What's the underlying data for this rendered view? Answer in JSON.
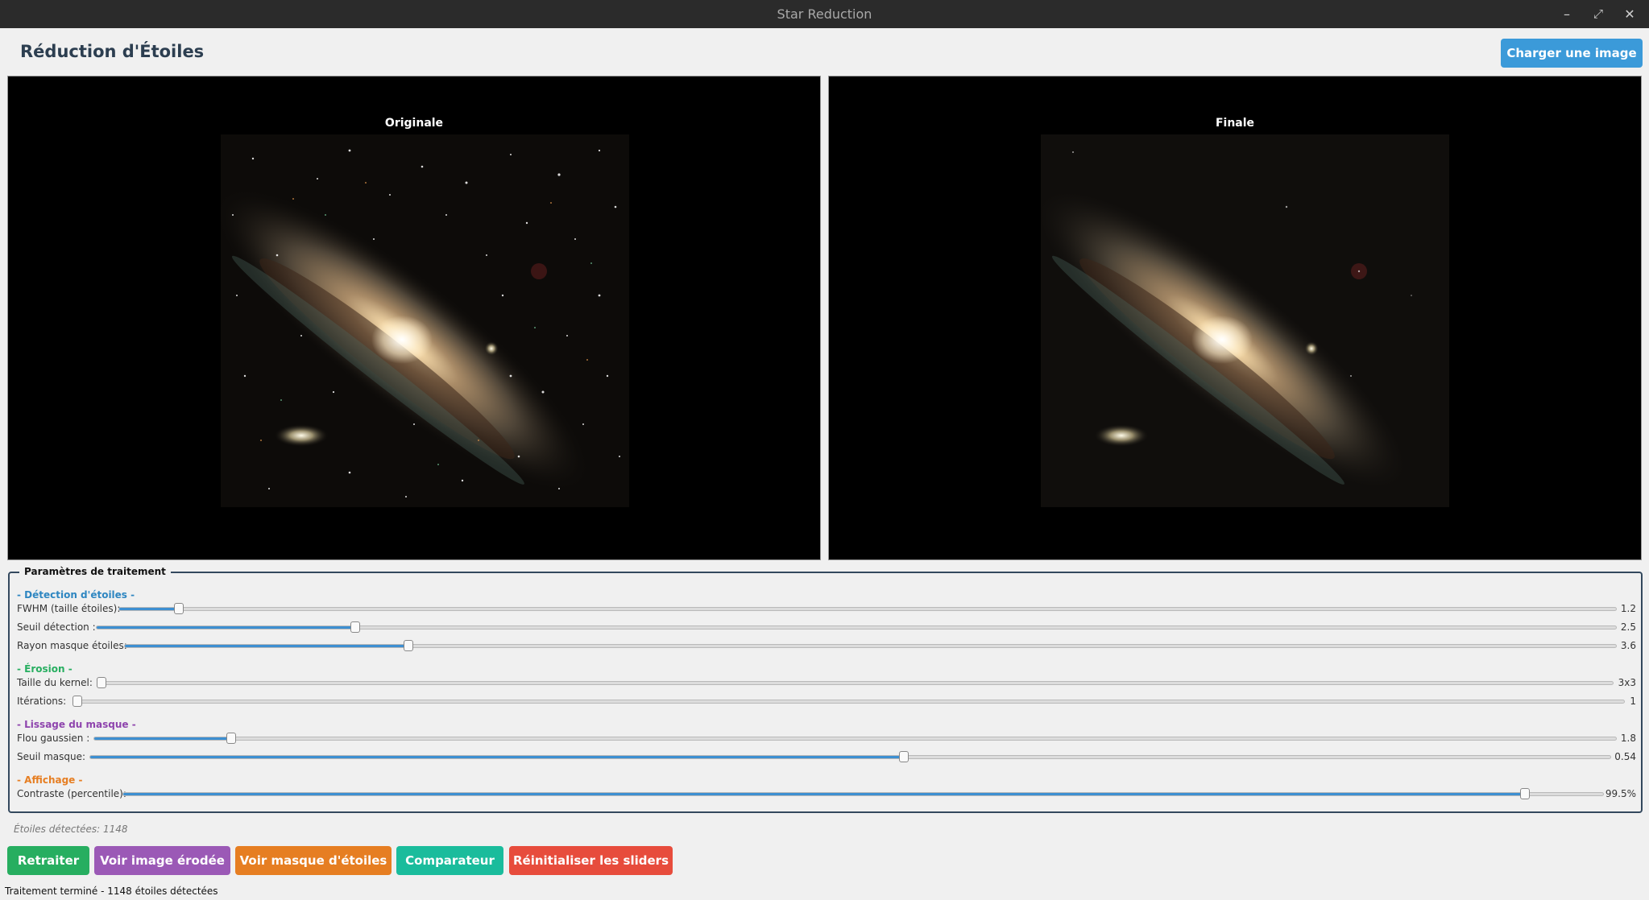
{
  "window": {
    "title": "Star Reduction",
    "controls": {
      "minimize": "–",
      "maximize": "⤢",
      "close": "✕"
    }
  },
  "header": {
    "title": "Réduction d'Étoiles",
    "load_button": "Charger une image"
  },
  "panels": {
    "left_title": "Originale",
    "right_title": "Finale"
  },
  "params": {
    "legend": "Paramètres de traitement",
    "detection": {
      "title": "- Détection d'étoiles -",
      "fwhm": {
        "label": "FWHM (taille étoiles):",
        "value": "1.2",
        "fraction": 0.04
      },
      "threshold": {
        "label": "Seuil détection :",
        "value": "2.5",
        "fraction": 0.17
      },
      "mask_radius": {
        "label": "Rayon masque étoiles:",
        "value": "3.6",
        "fraction": 0.19
      }
    },
    "erosion": {
      "title": "- Érosion -",
      "kernel": {
        "label": "Taille du kernel:",
        "value": "3x3",
        "fraction": 0.0
      },
      "iterations": {
        "label": "Itérations:",
        "value": "1",
        "fraction": 0.0
      }
    },
    "smoothing": {
      "title": "- Lissage du masque -",
      "blur": {
        "label": "Flou gaussien :",
        "value": "1.8",
        "fraction": 0.09
      },
      "mask_threshold": {
        "label": "Seuil masque:",
        "value": "0.54",
        "fraction": 0.535
      }
    },
    "display": {
      "title": "- Affichage -",
      "contrast": {
        "label": "Contraste (percentile):",
        "value": "99.5%",
        "fraction": 0.947
      }
    }
  },
  "stars_detected": "Étoiles détectées: 1148",
  "actions": {
    "reprocess": "Retraiter",
    "view_eroded": "Voir image érodée",
    "view_mask": "Voir masque d'étoiles",
    "comparator": "Comparateur",
    "reset": "Réinitialiser les sliders"
  },
  "status": "Traitement terminé - 1148 étoiles détectées",
  "colors": {
    "accent": "#3b9ad9",
    "green": "#27ae60",
    "purple": "#9b59b6",
    "orange": "#e67e22",
    "teal": "#1abc9c",
    "red": "#e74c3c"
  }
}
